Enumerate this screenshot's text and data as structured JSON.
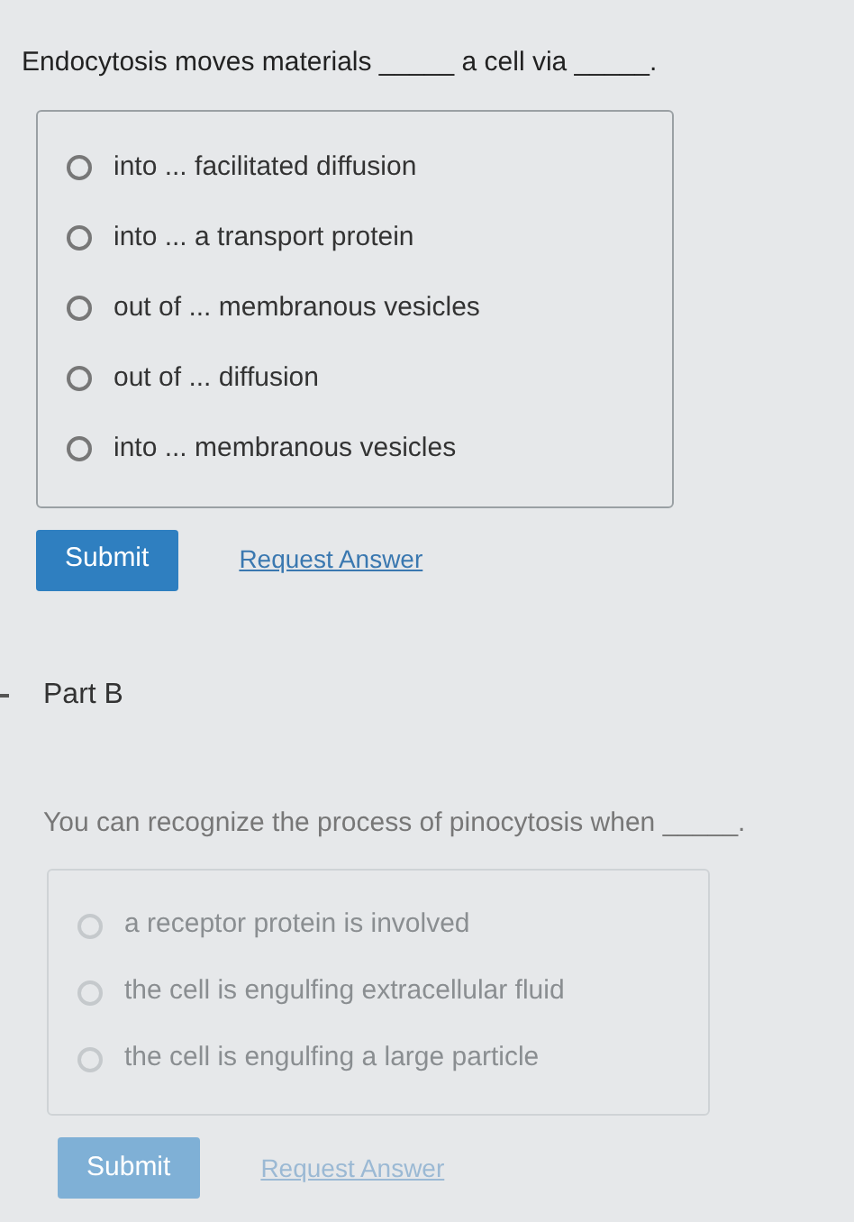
{
  "parts": [
    {
      "question": "Endocytosis moves materials _____ a cell via _____.",
      "options": [
        {
          "label": "into ... facilitated diffusion",
          "selected": false
        },
        {
          "label": "into ... a transport protein",
          "selected": false
        },
        {
          "label": "out of ... membranous vesicles",
          "selected": false
        },
        {
          "label": "out of ... diffusion",
          "selected": false
        },
        {
          "label": "into ... membranous vesicles",
          "selected": false
        }
      ],
      "submit": "Submit",
      "request_answer": "Request Answer",
      "faded": false
    },
    {
      "title": "Part B",
      "question": "You can recognize the process of pinocytosis when _____.",
      "options": [
        {
          "label": "a receptor protein is involved",
          "selected": false
        },
        {
          "label": "the cell is engulfing extracellular fluid",
          "selected": false
        },
        {
          "label": "the cell is engulfing a large particle",
          "selected": false
        }
      ],
      "submit": "Submit",
      "request_answer": "Request Answer",
      "faded": true
    }
  ]
}
